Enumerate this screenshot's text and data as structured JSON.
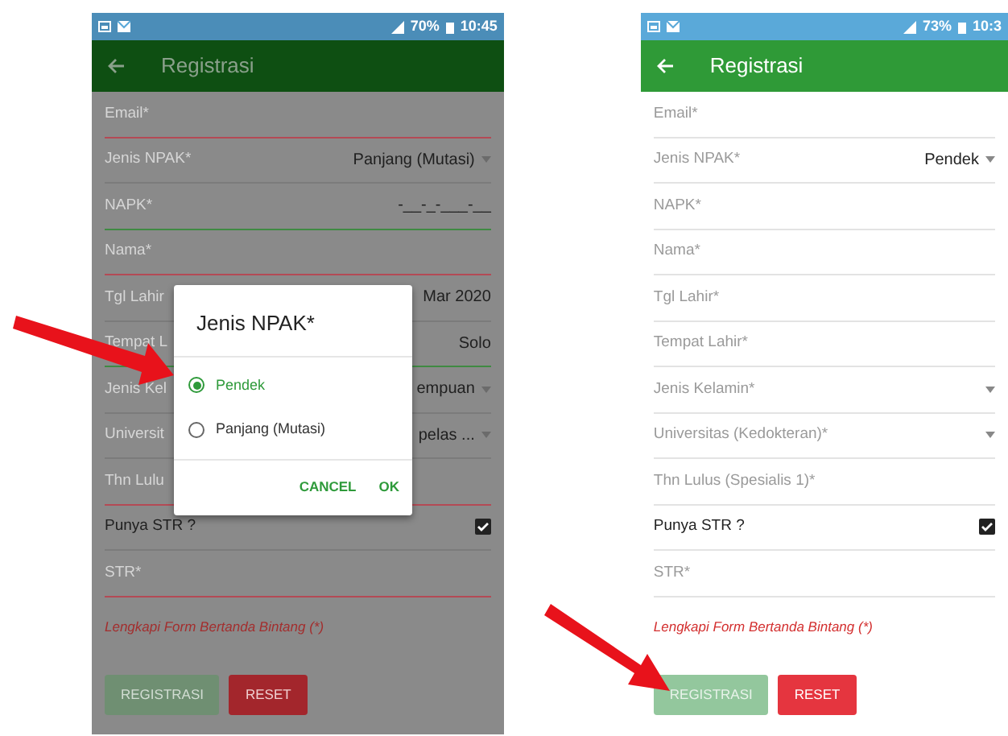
{
  "screens": [
    {
      "dimmed": true,
      "status_bar": {
        "battery": "70%",
        "time": "10:45"
      },
      "app_bar": {
        "title": "Registrasi"
      },
      "fields": [
        {
          "kind": "text",
          "label": "Email*",
          "error": true
        },
        {
          "kind": "select",
          "label": "Jenis NPAK*",
          "value": "Panjang (Mutasi)",
          "error": false,
          "valid": false
        },
        {
          "kind": "text",
          "label": "NAPK*",
          "value": "-__-_-___-__",
          "error": false,
          "valid": true
        },
        {
          "kind": "text",
          "label": "Nama*",
          "error": true
        },
        {
          "kind": "text",
          "label": "Tgl Lahir",
          "value": "Mar 2020",
          "error": false,
          "valid": false
        },
        {
          "kind": "text",
          "label": "Tempat L",
          "value": "Solo",
          "error": false,
          "valid": true
        },
        {
          "kind": "select",
          "label": "Jenis Kel",
          "value": "empuan",
          "error": false,
          "valid": false
        },
        {
          "kind": "select",
          "label": "Universit",
          "value": "pelas ...",
          "error": false,
          "valid": false
        },
        {
          "kind": "text",
          "label": "Thn Lulu",
          "error": true
        },
        {
          "kind": "checkbox",
          "label": "Punya STR ?",
          "checked": true
        },
        {
          "kind": "text",
          "label": "STR*",
          "error": true
        }
      ],
      "hint": "Lengkapi Form Bertanda Bintang (*)",
      "buttons": [
        {
          "label": "REGISTRASI",
          "kind": "primary",
          "disabled": true
        },
        {
          "label": "RESET",
          "kind": "danger",
          "disabled": false
        }
      ],
      "dialog": {
        "title": "Jenis NPAK*",
        "options": [
          {
            "label": "Pendek",
            "selected": true
          },
          {
            "label": "Panjang (Mutasi)",
            "selected": false
          }
        ],
        "actions": [
          "CANCEL",
          "OK"
        ]
      }
    },
    {
      "dimmed": false,
      "status_bar": {
        "battery": "73%",
        "time": "10:3"
      },
      "app_bar": {
        "title": "Registrasi"
      },
      "fields": [
        {
          "kind": "text",
          "label": "Email*",
          "error": false,
          "valid": false
        },
        {
          "kind": "select",
          "label": "Jenis NPAK*",
          "value": "Pendek",
          "error": false,
          "valid": false
        },
        {
          "kind": "text",
          "label": "NAPK*",
          "error": false,
          "valid": false
        },
        {
          "kind": "text",
          "label": "Nama*",
          "error": false,
          "valid": false
        },
        {
          "kind": "text",
          "label": "Tgl Lahir*",
          "error": false,
          "valid": false
        },
        {
          "kind": "text",
          "label": "Tempat Lahir*",
          "error": false,
          "valid": false
        },
        {
          "kind": "select",
          "label": "Jenis Kelamin*",
          "error": false,
          "valid": false
        },
        {
          "kind": "select",
          "label": "Universitas (Kedokteran)*",
          "error": false,
          "valid": false
        },
        {
          "kind": "text",
          "label": "Thn Lulus (Spesialis 1)*",
          "error": false,
          "valid": false
        },
        {
          "kind": "checkbox",
          "label": "Punya STR ?",
          "checked": true
        },
        {
          "kind": "text",
          "label": "STR*",
          "error": false,
          "valid": false
        }
      ],
      "hint": "Lengkapi Form Bertanda Bintang (*)",
      "buttons": [
        {
          "label": "REGISTRASI",
          "kind": "primary",
          "disabled": true
        },
        {
          "label": "RESET",
          "kind": "danger",
          "disabled": false
        }
      ]
    }
  ]
}
